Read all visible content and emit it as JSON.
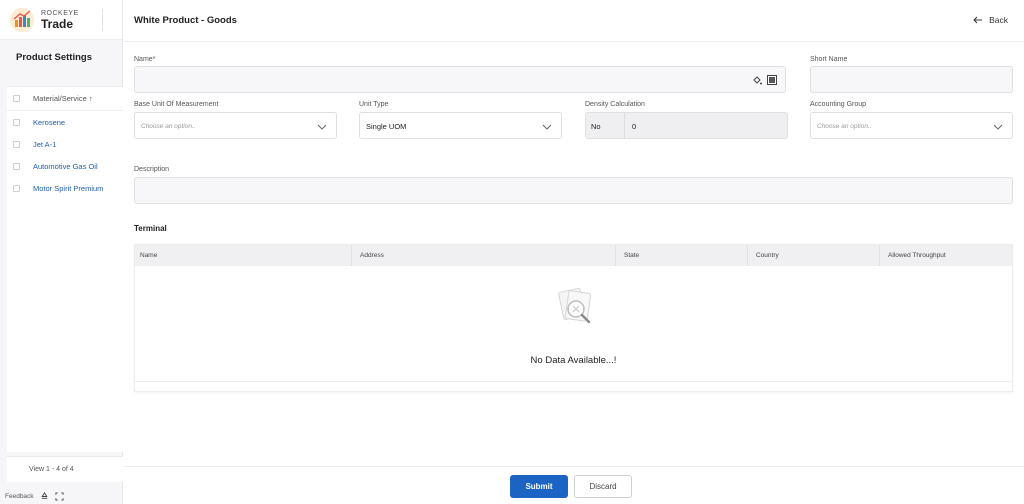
{
  "brand": {
    "small": "ROCKEYE",
    "big": "Trade"
  },
  "sidebar": {
    "title": "Product Settings",
    "column_header": "Material/Service ↑",
    "items": [
      "Kerosene",
      "Jet A-1",
      "Automotive Gas Oil",
      "Motor Spirit Premium"
    ],
    "footer": "View 1 - 4 of 4",
    "feedback": "Feedback"
  },
  "header": {
    "title": "White Product - Goods",
    "back_label": "Back"
  },
  "form": {
    "name_label": "Name*",
    "name_value": "",
    "short_name_label": "Short Name",
    "short_name_value": "",
    "base_uom_label": "Base Unit Of Measurement",
    "base_uom_placeholder": "Choose an option..",
    "unit_type_label": "Unit Type",
    "unit_type_value": "Single UOM",
    "density_label": "Density Calculation",
    "density_flag": "No",
    "density_value": "0",
    "accounting_label": "Accounting Group",
    "accounting_placeholder": "Choose an option..",
    "description_label": "Description",
    "description_value": ""
  },
  "terminal": {
    "title": "Terminal",
    "columns": [
      "Name",
      "Address",
      "State",
      "Country",
      "Allowed Throughput"
    ],
    "empty_text": "No Data Available...!"
  },
  "actions": {
    "submit": "Submit",
    "discard": "Discard"
  },
  "colors": {
    "primary": "#1c64c4",
    "link": "#1f5fae"
  }
}
